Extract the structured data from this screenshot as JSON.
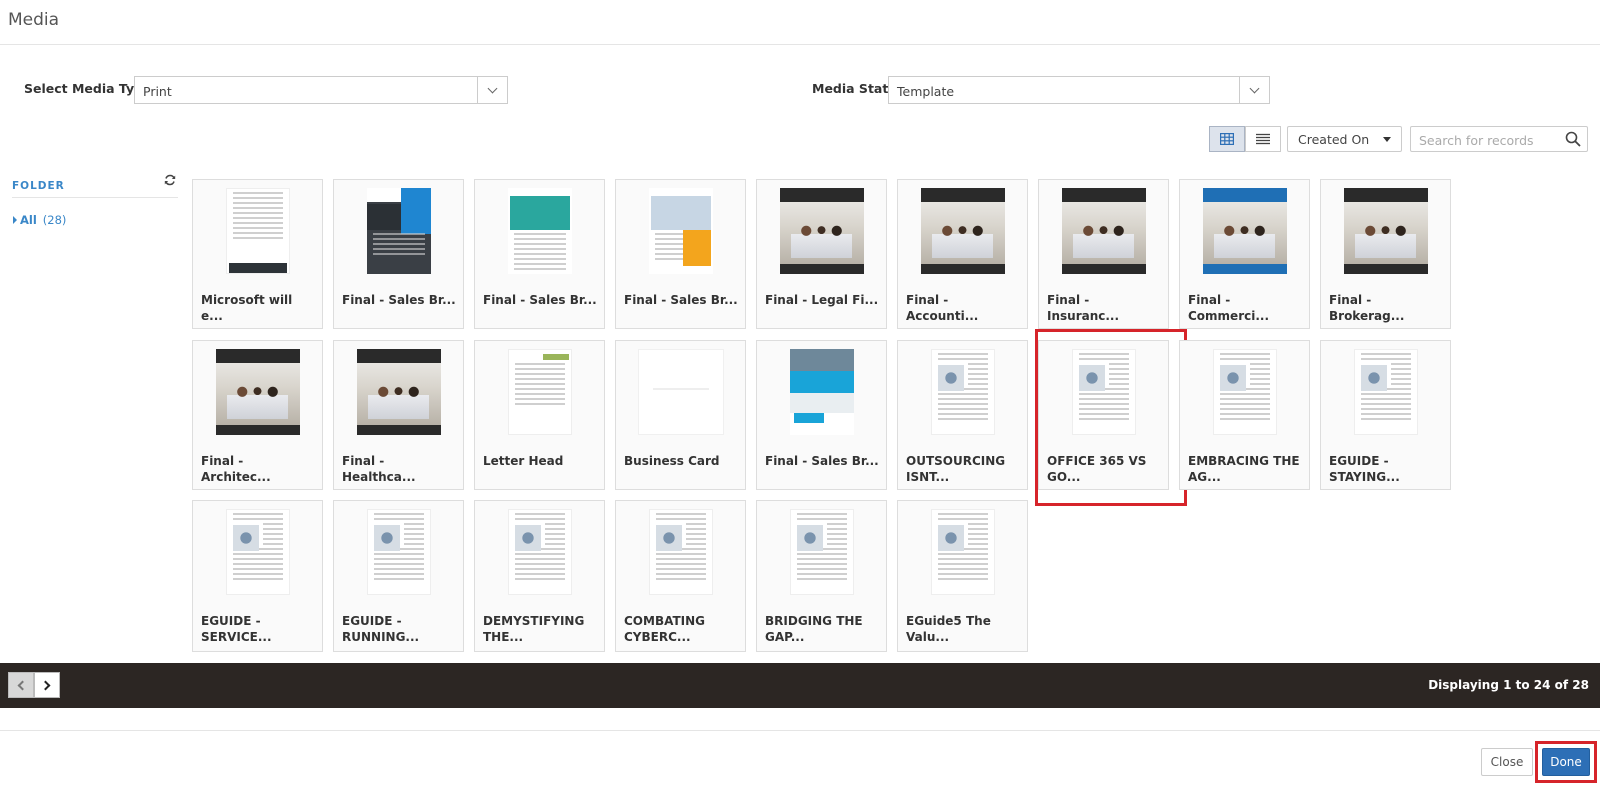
{
  "window": {
    "title": "Media"
  },
  "filters": {
    "media_type_label": "Select Media Type:",
    "media_type_value": "Print",
    "media_state_label": "Media State:",
    "media_state_value": "Template"
  },
  "toolbar": {
    "sort_value": "Created On",
    "search_placeholder": "Search for records",
    "view_mode": "grid"
  },
  "sidebar": {
    "folder_label": "FOLDER",
    "items": [
      {
        "label": "All",
        "count": "(28)"
      }
    ]
  },
  "media_items": [
    {
      "name": "Microsoft will e...",
      "thumb": "doc"
    },
    {
      "name": "Final - Sales Br...",
      "thumb": "brochure-blue"
    },
    {
      "name": "Final - Sales Br...",
      "thumb": "brochure-teal"
    },
    {
      "name": "Final - Sales Br...",
      "thumb": "brochure-orange"
    },
    {
      "name": "Final - Legal Fi...",
      "thumb": "flyer-dark"
    },
    {
      "name": "Final - Accounti...",
      "thumb": "flyer-dark"
    },
    {
      "name": "Final - Insuranc...",
      "thumb": "flyer-dark"
    },
    {
      "name": "Final - Commerci...",
      "thumb": "flyer-blue"
    },
    {
      "name": "Final - Brokerag...",
      "thumb": "flyer-dark"
    },
    {
      "name": "Final - Architec...",
      "thumb": "flyer-dark"
    },
    {
      "name": "Final - Healthca...",
      "thumb": "flyer-dark"
    },
    {
      "name": "Letter Head",
      "thumb": "letterhead"
    },
    {
      "name": "Business Card",
      "thumb": "blank"
    },
    {
      "name": "Final - Sales Br...",
      "thumb": "brochure-cyan"
    },
    {
      "name": "OUTSOURCING ISNT...",
      "thumb": "eguide"
    },
    {
      "name": "OFFICE 365 VS GO...",
      "thumb": "eguide",
      "highlighted": true
    },
    {
      "name": "EMBRACING THE AG...",
      "thumb": "eguide"
    },
    {
      "name": "EGUIDE - STAYING...",
      "thumb": "eguide"
    },
    {
      "name": "EGUIDE - SERVICE...",
      "thumb": "eguide"
    },
    {
      "name": "EGUIDE - RUNNING...",
      "thumb": "eguide"
    },
    {
      "name": "DEMYSTIFYING THE...",
      "thumb": "eguide"
    },
    {
      "name": "COMBATING CYBERC...",
      "thumb": "eguide"
    },
    {
      "name": "BRIDGING THE GAP...",
      "thumb": "eguide"
    },
    {
      "name": "EGuide5 The Valu...",
      "thumb": "eguide"
    }
  ],
  "pagination": {
    "display_text": "Displaying 1 to 24 of 28"
  },
  "actions": {
    "close_label": "Close",
    "done_label": "Done",
    "done_highlighted": true
  },
  "colors": {
    "accent": "#3a87c8",
    "primary": "#2d6fb6",
    "highlight": "#d6242a",
    "footer": "#2c2623"
  }
}
